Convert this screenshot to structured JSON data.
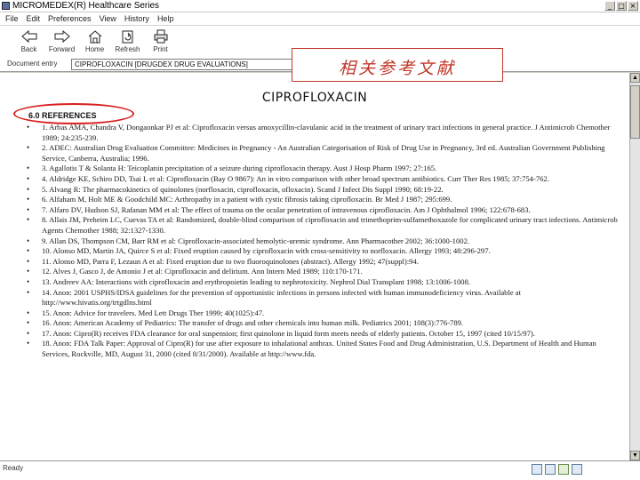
{
  "window": {
    "title": "MICROMEDEX(R) Healthcare Series",
    "controls": [
      "_",
      "□",
      "×"
    ]
  },
  "menu": [
    "File",
    "Edit",
    "Preferences",
    "View",
    "History",
    "Help"
  ],
  "toolbar": [
    {
      "label": "Back",
      "icon": "back-arrow-icon"
    },
    {
      "label": "Forward",
      "icon": "forward-arrow-icon"
    },
    {
      "label": "Home",
      "icon": "home-icon"
    },
    {
      "label": "Refresh",
      "icon": "refresh-icon"
    },
    {
      "label": "Print",
      "icon": "printer-icon"
    }
  ],
  "doc_entry": {
    "label": "Document entry",
    "value": "CIPROFLOXACIN [DRUGDEX DRUG EVALUATIONS]"
  },
  "annotation": {
    "text": "相关参考文献",
    "color": "#c0392b"
  },
  "document": {
    "title": "CIPROFLOXACIN",
    "section": "6.0 REFERENCES",
    "references": [
      "1. Arbas AMA, Chandra V, Dongaonkar PJ et al: Ciprofloxacin versus amoxycillin-clavulanic acid in the treatment of urinary tract infections in general practice. J Antimicrob Chemother 1989; 24:235-239.",
      "2. ADEC: Australian Drug Evaluation Committee: Medicines in Pregnancy - An Australian Categorisation of Risk of Drug Use in Pregnancy, 3rd ed. Australian Government Publishing Service, Canberra, Australia; 1996.",
      "3. Agallotis T & Solanta H: Teicoplanin precipitation of a seizure during ciprofloxacin therapy. Aust J Hosp Pharm 1997; 27:165.",
      "4. Aldridge KE, Schiro DD, Tsai L et al: Ciprofloxacin (Bay O 9867): An in vitro comparison with other broad spectrum antibiotics. Curr Ther Res 1985; 37:754-762.",
      "5. Alvang R: The pharmacokinetics of quinolones (norfloxacin, ciprofloxacin, ofloxacin). Scand J Infect Dis Suppl 1990; 68:19-22.",
      "6. Alfaham M, Holt ME & Goodchild MC: Arthropathy in a patient with cystic fibrosis taking ciprofloxacin. Br Med J 1987; 295:699.",
      "7. Alfaro DV, Hudson SJ, Rafanan MM et al: The effect of trauma on the ocular penetration of intravenous ciprofloxacin. Am J Ophthalmol 1996; 122:678-683.",
      "8. Allais JM, Preheim LC, Cuevas TA et al: Randomized, double-blind comparison of ciprofloxacin and trimethoprim-sulfamethoxazole for complicated urinary tract infections. Antimicrob Agents Chemother 1988; 32:1327-1330.",
      "9. Allan DS, Thompson CM, Barr RM et al: Ciprofloxacin-associated hemolytic-uremic syndrome. Ann Pharmacother 2002; 36:1000-1002.",
      "10. Alonso MD, Martin JA, Quirce S et al: Fixed eruption caused by ciprofloxacin with cross-sensitivity to norfloxacin. Allergy 1993; 48:296-297.",
      "11. Alonso MD, Parra F, Lezaun A et al: Fixed eruption due to two fluoroquinolones (abstract). Allergy 1992; 47(suppl):94.",
      "12. Alves J, Gasco J, de Antonio J et al: Ciprofloxacin and delirium. Ann Intern Med 1989; 110:170-171.",
      "13. Andreev AA: Interactions with ciprofloxacin and erythropoietin leading to nephrotoxicity. Nephrol Dial Transplant 1998; 13:1006-1008.",
      "14. Anon: 2001 USPHS/IDSA guidelines for the prevention of opportunistic infections in persons infected with human immunodeficiency virus. Available at http://www.hivatis.org/trtgdlns.html",
      "15. Anon: Advice for travelers. Med Lett Drugs Ther 1999; 40(1025):47.",
      "16. Anon: American Academy of Pediatrics: The transfer of drugs and other chemicals into human milk. Pediatrics 2001; 108(3):776-789.",
      "17. Anon: Cipro(R) receives FDA clearance for oral suspension; first quinolone in liquid form meets needs of elderly patients. October 15, 1997 (cited 10/15/97).",
      "18. Anon: FDA Talk Paper: Approval of Cipro(R) for use after exposure to inhalational anthrax. United States Food and Drug Administration, U.S. Department of Health and Human Services, Rockville, MD, August 31, 2000 (cited 8/31/2000). Available at http://www.fda."
    ]
  },
  "status": {
    "text": "Ready"
  }
}
